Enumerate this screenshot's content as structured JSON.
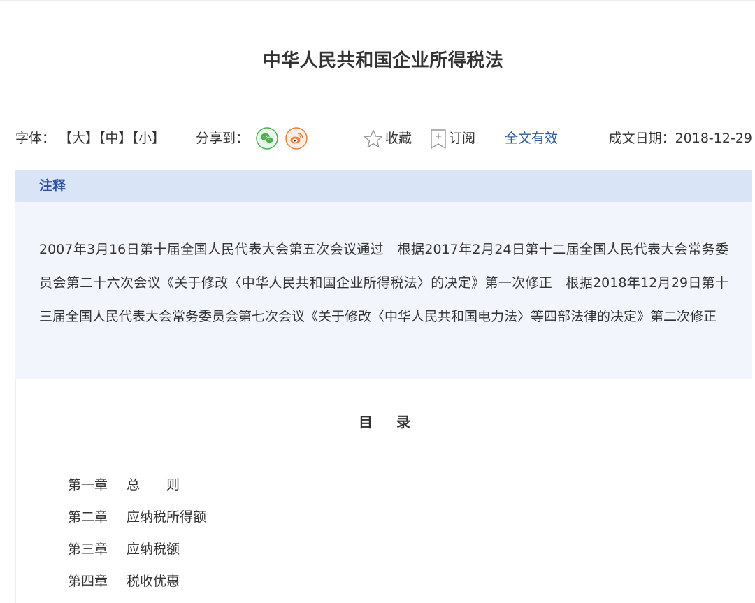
{
  "document": {
    "title": "中华人民共和国企业所得税法"
  },
  "toolbar": {
    "font_label": "字体：",
    "font_sizes": [
      "【大】",
      "【中】",
      "【小】"
    ],
    "share_label": "分享到：",
    "share_icons": [
      "wechat-icon",
      "weibo-icon"
    ],
    "favorite_label": "收藏",
    "subscribe_label": "订阅",
    "validity": "全文有效",
    "date_label": "成文日期：2018-12-29"
  },
  "notes": {
    "header": "注释",
    "text": "2007年3月16日第十届全国人民代表大会第五次会议通过　根据2017年2月24日第十二届全国人民代表大会常务委员会第二十六次会议《关于修改〈中华人民共和国企业所得税法〉的决定》第一次修正　根据2018年12月29日第十三届全国人民代表大会常务委员会第七次会议《关于修改〈中华人民共和国电力法〉等四部法律的决定》第二次修正"
  },
  "toc": {
    "title_part1": "目",
    "title_part2": "录",
    "items": [
      {
        "chapter": "第一章",
        "name": "总　　则"
      },
      {
        "chapter": "第二章",
        "name": "应纳税所得额"
      },
      {
        "chapter": "第三章",
        "name": "应纳税额"
      },
      {
        "chapter": "第四章",
        "name": "税收优惠"
      }
    ]
  },
  "colors": {
    "accent_blue": "#2c5aa0",
    "notes_header_bg": "#d9e5f7",
    "notes_body_bg": "#f2f6fc",
    "wechat_green": "#4caf50",
    "weibo_orange": "#f07d3c"
  }
}
